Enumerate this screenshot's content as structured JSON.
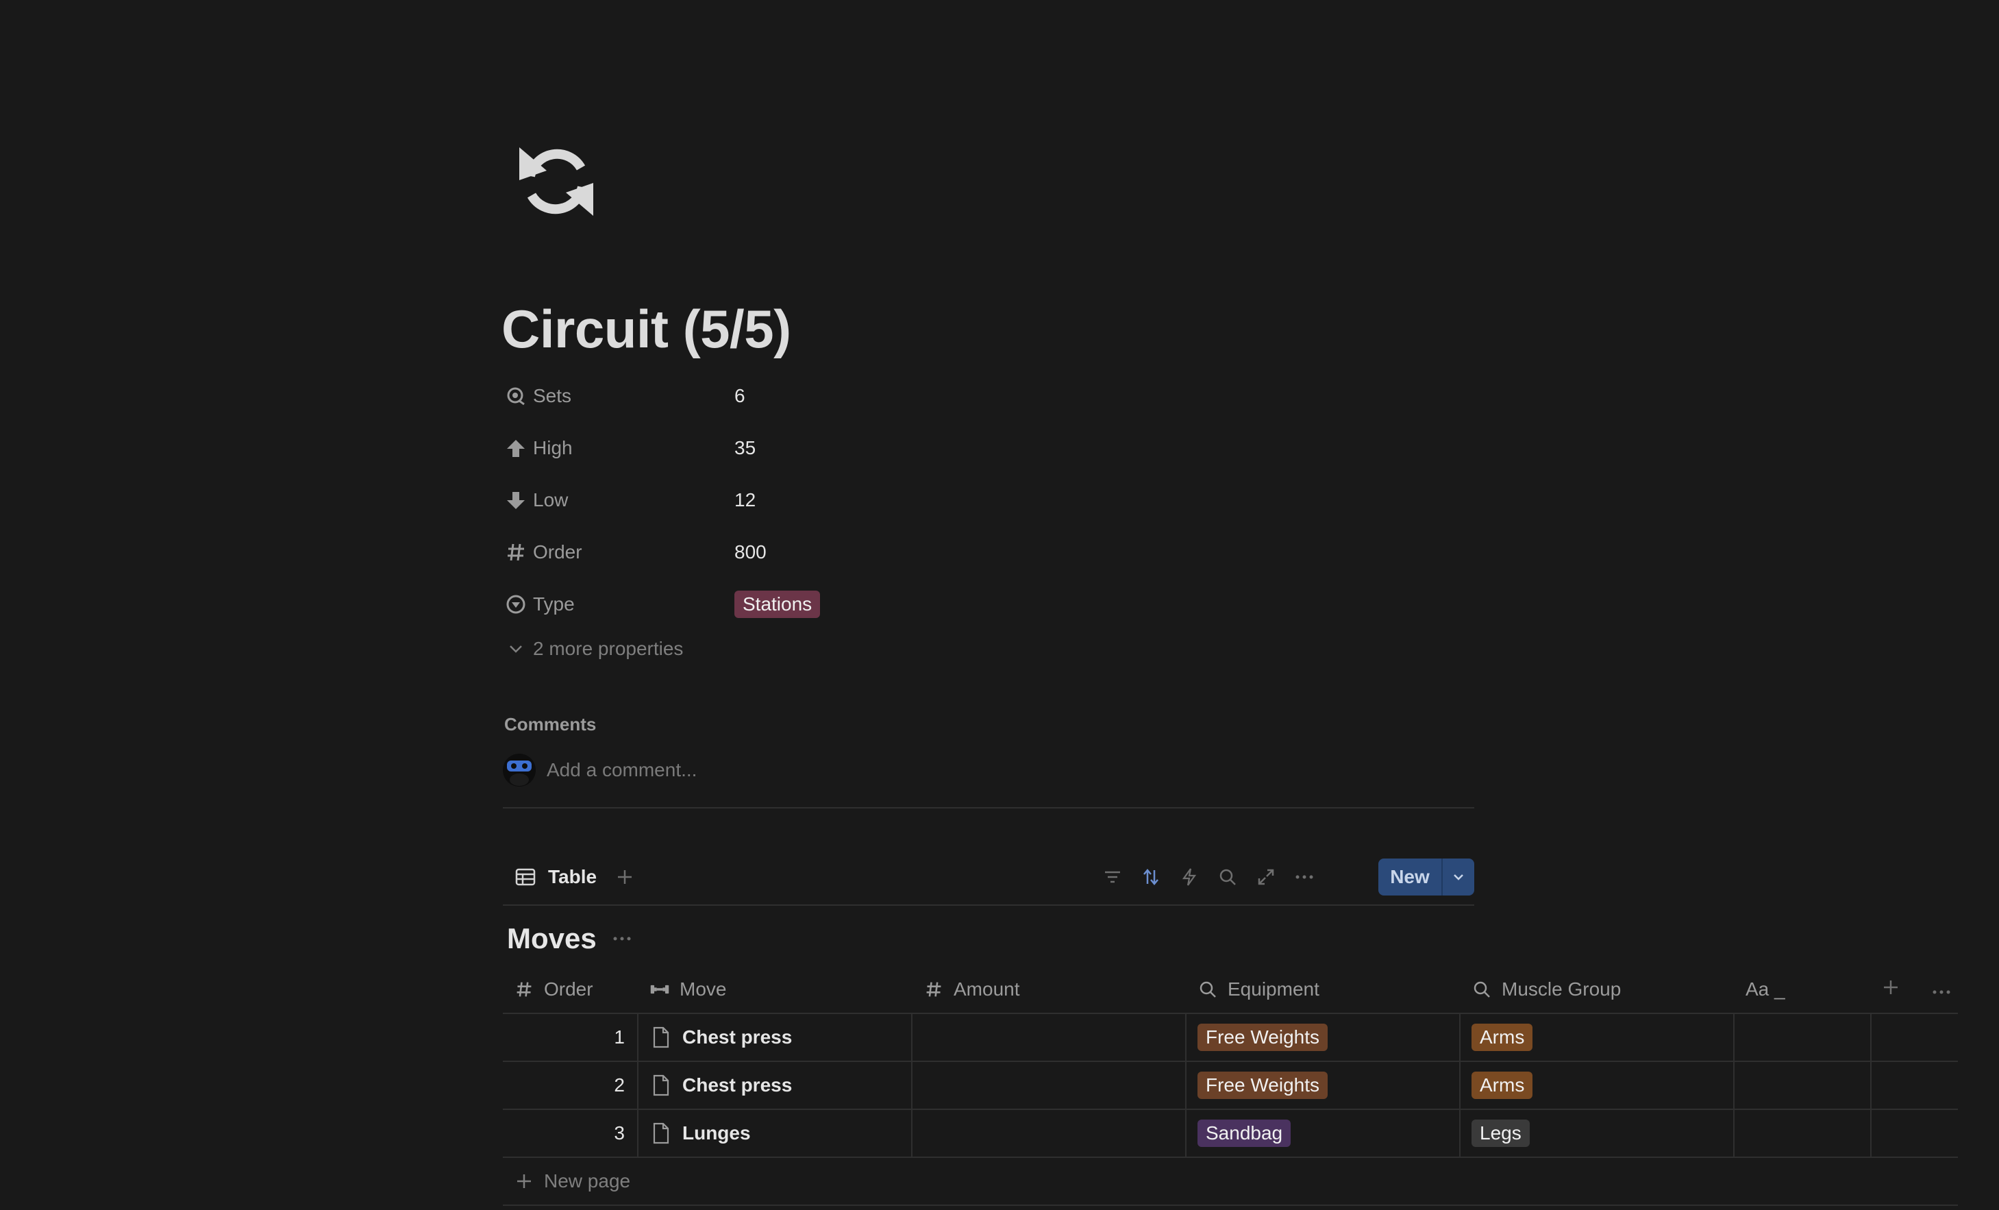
{
  "page": {
    "icon": "refresh-arrows-icon",
    "title": "Circuit (5/5)"
  },
  "properties": [
    {
      "label": "Sets",
      "icon": "sets-icon",
      "value": "6"
    },
    {
      "label": "High",
      "icon": "arrow-up-icon",
      "value": "35"
    },
    {
      "label": "Low",
      "icon": "arrow-down-icon",
      "value": "12"
    },
    {
      "label": "Order",
      "icon": "hash-icon",
      "value": "800"
    },
    {
      "label": "Type",
      "icon": "select-icon",
      "value": "Stations"
    }
  ],
  "more_properties": "2 more properties",
  "comments": {
    "heading": "Comments",
    "placeholder": "Add a comment..."
  },
  "view": {
    "tab_label": "Table",
    "new_label": "New"
  },
  "database": {
    "title": "Moves",
    "columns": [
      "Order",
      "Move",
      "Amount",
      "Equipment",
      "Muscle Group",
      "Aa _"
    ],
    "rows": [
      {
        "order": "1",
        "move": "Chest press",
        "amount": "",
        "equipment": "Free Weights",
        "muscle": "Arms"
      },
      {
        "order": "2",
        "move": "Chest press",
        "amount": "",
        "equipment": "Free Weights",
        "muscle": "Arms"
      },
      {
        "order": "3",
        "move": "Lunges",
        "amount": "",
        "equipment": "Sandbag",
        "muscle": "Legs"
      }
    ],
    "new_page_label": "New page"
  },
  "colors": {
    "background": "#191919",
    "tag_stations": "#6b3548",
    "tag_free_weights": "#6b4128",
    "tag_arms": "#7a4a22",
    "tag_sandbag": "#4a325f",
    "tag_legs": "#3a3a3a",
    "new_button": "#2b4a7a"
  }
}
